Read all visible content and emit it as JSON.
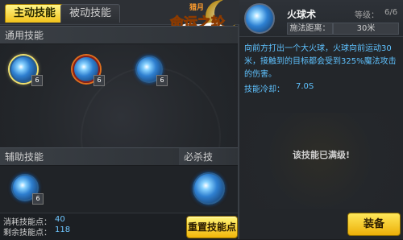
{
  "tabs": {
    "active": "主动技能",
    "passive": "被动技能"
  },
  "logo": {
    "text": "命运之轮",
    "small": "猎月"
  },
  "sections": {
    "common": "通用技能",
    "auxiliary": "辅助技能",
    "ultimate": "必杀技"
  },
  "skills": {
    "common": [
      {
        "name": "fireball",
        "level": "6",
        "selected": true
      },
      {
        "name": "whirlwind",
        "level": "6"
      },
      {
        "name": "meteor-shot",
        "level": "6"
      }
    ],
    "auxiliary": [
      {
        "name": "heart",
        "level": "6"
      }
    ],
    "ultimate": [
      {
        "name": "star-fall"
      }
    ]
  },
  "stats": {
    "used_label": "消耗技能点：",
    "used_value": "40",
    "remain_label": "剩余技能点：",
    "remain_value": "118"
  },
  "buttons": {
    "reset": "重置技能点",
    "equip": "装备"
  },
  "info": {
    "name": "火球术",
    "level_label": "等级：",
    "level_value": "6/6",
    "range_label": "施法距离：",
    "range_value": "30米",
    "description": "向前方打出一个大火球，火球向前运动30米，接触到的目标都会受到325%魔法攻击的伤害。",
    "cooldown_label": "技能冷却：",
    "cooldown_value": "7.0S",
    "max_notice": "该技能已满级!"
  }
}
